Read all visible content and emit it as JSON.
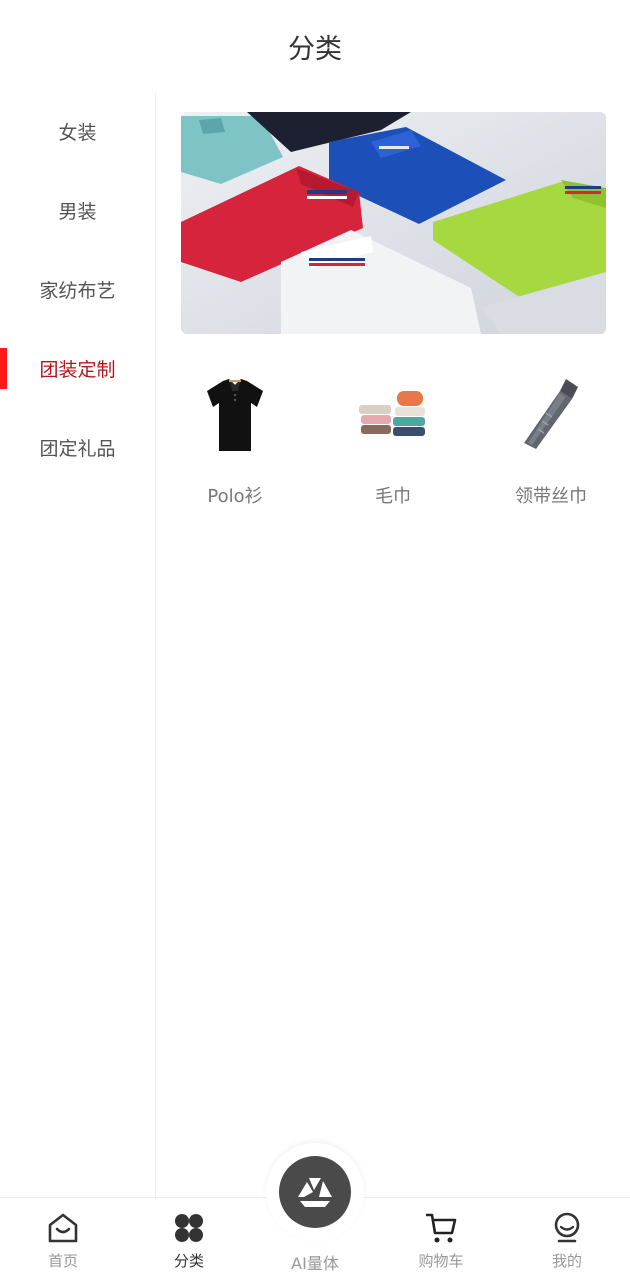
{
  "header": {
    "title": "分类"
  },
  "sidebar": {
    "items": [
      {
        "label": "女装",
        "active": false
      },
      {
        "label": "男装",
        "active": false
      },
      {
        "label": "家纺布艺",
        "active": false
      },
      {
        "label": "团装定制",
        "active": true
      },
      {
        "label": "团定礼品",
        "active": false
      }
    ],
    "active_color": "#b0181e",
    "indicator_color": "#ff1a1a"
  },
  "banner": {
    "image": "folded-polo-shirts-photo"
  },
  "categories": [
    {
      "label": "Polo衫",
      "icon": "black-polo-shirt-image"
    },
    {
      "label": "毛巾",
      "icon": "stacked-towels-image"
    },
    {
      "label": "领带丝巾",
      "icon": "striped-tie-image"
    }
  ],
  "tabbar": {
    "tabs": [
      {
        "label": "首页",
        "icon": "home-icon",
        "active": false
      },
      {
        "label": "分类",
        "icon": "category-grid-icon",
        "active": true
      },
      {
        "label": "AI量体",
        "icon": "ai-measure-icon",
        "active": false
      },
      {
        "label": "购物车",
        "icon": "cart-icon",
        "active": false
      },
      {
        "label": "我的",
        "icon": "profile-icon",
        "active": false
      }
    ]
  }
}
